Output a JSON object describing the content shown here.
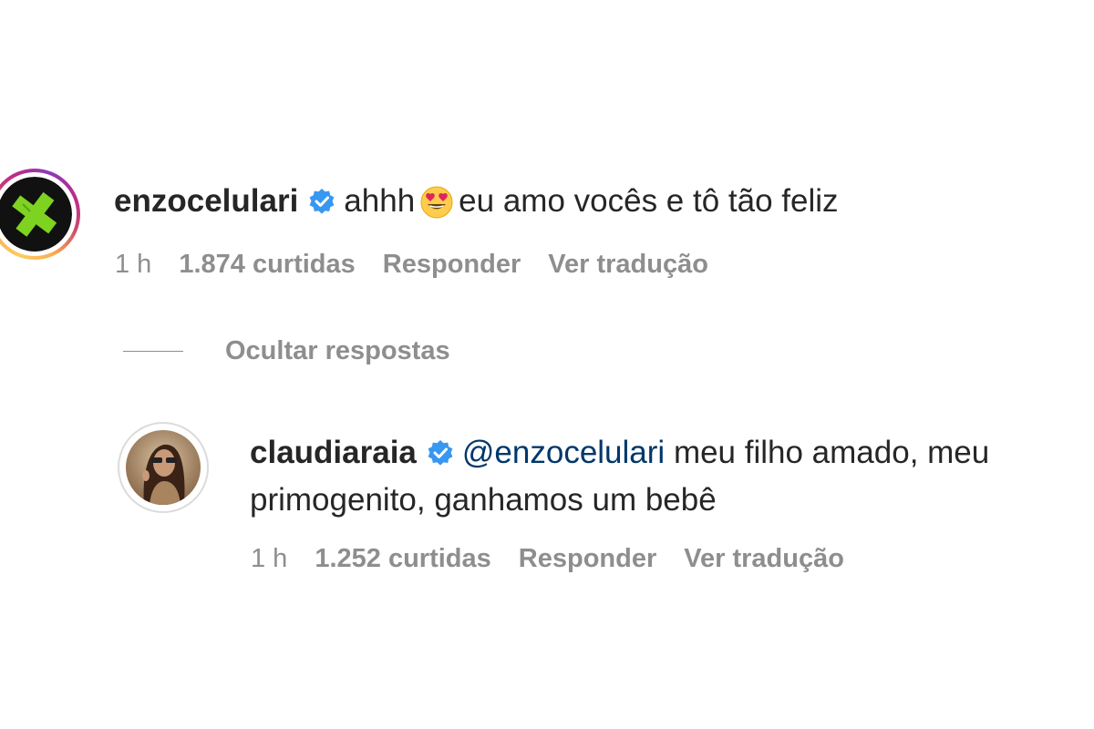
{
  "comments": [
    {
      "username": "enzocelulari",
      "text_before_emoji": "ahhh",
      "emoji_icon": "heart-eyes-emoji",
      "text_after_emoji": "eu amo vocês e tô tão feliz",
      "time": "1 h",
      "likes": "1.874 curtidas",
      "reply": "Responder",
      "translate": "Ver tradução"
    }
  ],
  "hide_replies": "Ocultar respostas",
  "replies": [
    {
      "username": "claudiaraia",
      "mention": "@enzocelulari",
      "text_line1": "meu filho amado, meu",
      "text_line2": "primogenito, ganhamos um bebê",
      "time": "1 h",
      "likes": "1.252 curtidas",
      "reply": "Responder",
      "translate": "Ver tradução"
    }
  ],
  "colors": {
    "verified": "#3897f0",
    "mention": "#00376b",
    "meta": "#8e8e8e",
    "avatar_green": "#7ed321"
  }
}
